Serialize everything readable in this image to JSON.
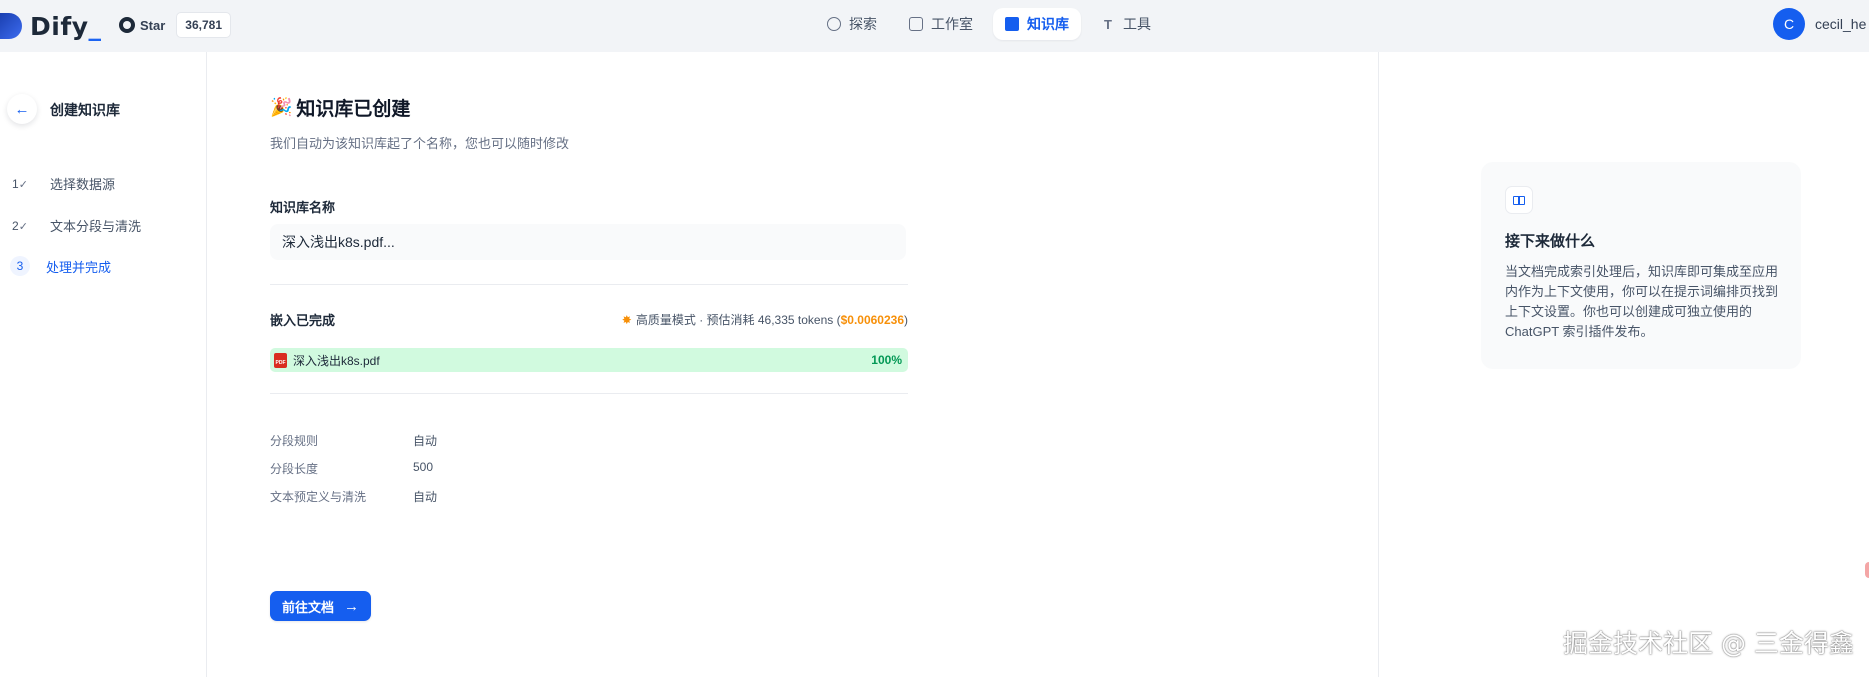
{
  "header": {
    "logo_text": "Dify",
    "logo_underscore": "_",
    "github": {
      "label": "Star",
      "count": "36,781"
    },
    "nav": [
      {
        "label": "探索",
        "icon": "compass-icon",
        "active": false
      },
      {
        "label": "工作室",
        "icon": "robot-icon",
        "active": false
      },
      {
        "label": "知识库",
        "icon": "book-icon",
        "active": true
      },
      {
        "label": "工具",
        "icon": "tool-icon",
        "active": false
      }
    ],
    "user": {
      "initial": "C",
      "name": "cecil_he"
    }
  },
  "sidebar": {
    "back_icon": "←",
    "title": "创建知识库",
    "steps": [
      {
        "num": "1",
        "check": "✓",
        "label": "选择数据源",
        "active": false
      },
      {
        "num": "2",
        "check": "✓",
        "label": "文本分段与清洗",
        "active": false
      },
      {
        "num": "3",
        "check": "",
        "label": "处理并完成",
        "active": true
      }
    ]
  },
  "main": {
    "title_emoji": "🎉",
    "title": "知识库已创建",
    "subtitle": "我们自动为该知识库起了个名称，您也可以随时修改",
    "name_label": "知识库名称",
    "name_value": "深入浅出k8s.pdf...",
    "embed_title": "嵌入已完成",
    "embed_mode": "高质量模式 · 预估消耗 46,335 tokens (",
    "embed_price": "$0.0060236",
    "embed_close": ")",
    "file": {
      "name": "深入浅出k8s.pdf",
      "percent": "100%",
      "progress": 1.0,
      "icon_text": "PDF"
    },
    "settings": [
      {
        "key": "分段规则",
        "value": "自动"
      },
      {
        "key": "分段长度",
        "value": "500"
      },
      {
        "key": "文本预定义与清洗",
        "value": "自动"
      }
    ],
    "button": {
      "label": "前往文档",
      "arrow": "→"
    }
  },
  "next_card": {
    "title": "接下来做什么",
    "text": "当文档完成索引处理后，知识库即可集成至应用内作为上下文使用，你可以在提示词编排页找到上下文设置。你也可以创建成可独立使用的 ChatGPT 索引插件发布。"
  },
  "watermark": "掘金技术社区 @ 三金得鑫"
}
